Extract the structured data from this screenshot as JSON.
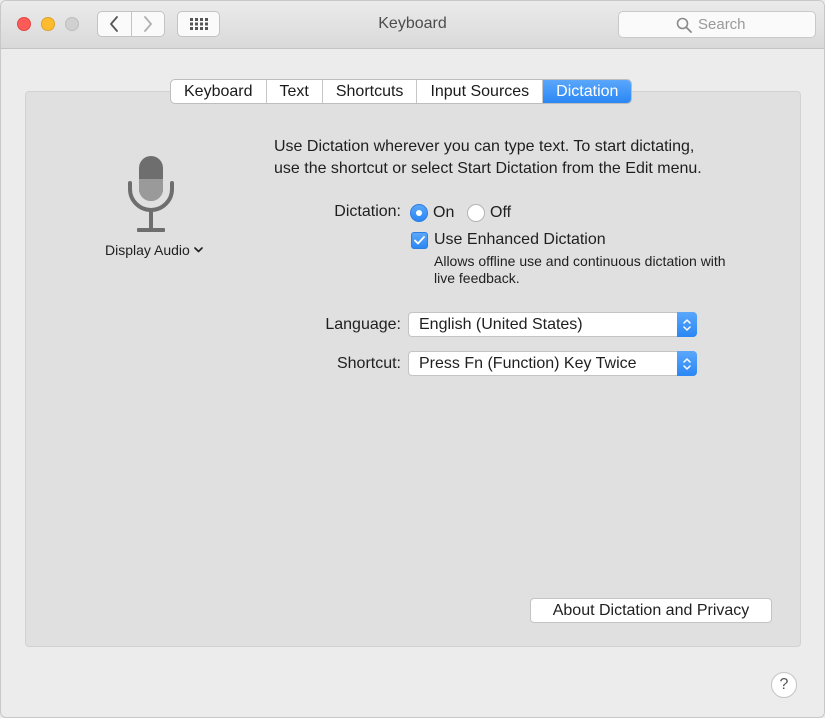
{
  "window": {
    "title": "Keyboard"
  },
  "search": {
    "placeholder": "Search"
  },
  "tabs": [
    {
      "label": "Keyboard",
      "active": false
    },
    {
      "label": "Text",
      "active": false
    },
    {
      "label": "Shortcuts",
      "active": false
    },
    {
      "label": "Input Sources",
      "active": false
    },
    {
      "label": "Dictation",
      "active": true
    }
  ],
  "mic": {
    "source_label": "Display Audio"
  },
  "description": {
    "line1": "Use Dictation wherever you can type text. To start dictating,",
    "line2": "use the shortcut or select Start Dictation from the Edit menu."
  },
  "dictation": {
    "label": "Dictation:",
    "on_label": "On",
    "off_label": "Off",
    "selected": "On"
  },
  "enhanced": {
    "label": "Use Enhanced Dictation",
    "checked": true,
    "help_line1": "Allows offline use and continuous dictation with",
    "help_line2": "live feedback."
  },
  "language": {
    "label": "Language:",
    "value": "English (United States)"
  },
  "shortcut": {
    "label": "Shortcut:",
    "value": "Press Fn (Function) Key Twice"
  },
  "about_button": {
    "label": "About Dictation and Privacy"
  },
  "help_button": {
    "label": "?"
  },
  "colors": {
    "accent": "#2b87f4",
    "close": "#fd5b57",
    "minimize": "#febb2e",
    "zoom_disabled": "#d0d0d0"
  }
}
